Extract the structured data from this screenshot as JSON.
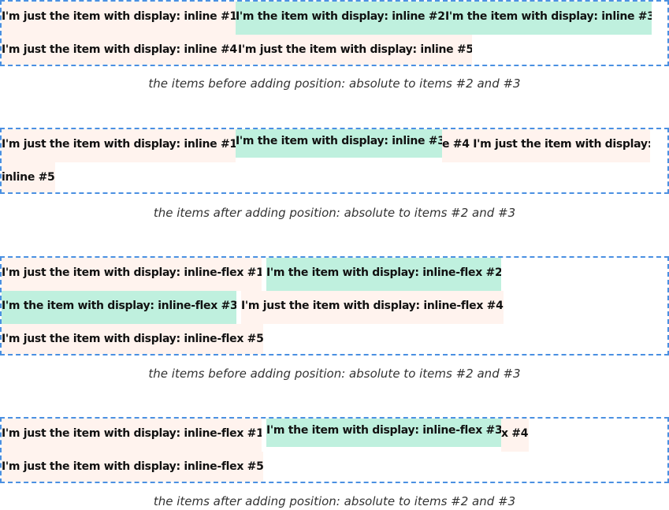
{
  "demos": [
    {
      "caption": "the items before adding position: absolute to items #2 and #3",
      "items": [
        "I'm just the item with display: inline #1",
        "I'm the item with display: inline #2",
        "I'm the item with display: inline #3",
        "I'm just the item with display: inline #4",
        "I'm just the item with display: inline #5"
      ]
    },
    {
      "caption": "the items after adding position: absolute to items #2 and #3",
      "items": [
        "I'm just the item with display: inline #1",
        "I'm the item with display: inline #3",
        "e #4 I'm just the item with display:",
        "inline #5"
      ]
    },
    {
      "caption": "the items before adding position: absolute to items #2 and #3",
      "items": [
        "I'm just the item with display: inline-flex #1",
        "I'm the item with display: inline-flex #2",
        "I'm the item with display: inline-flex #3",
        "I'm just the item with display: inline-flex #4",
        "I'm just the item with display: inline-flex #5"
      ]
    },
    {
      "caption": "the items after adding position: absolute to items #2 and #3",
      "items": [
        "I'm just the item with display: inline-flex #1",
        "I'm the item with display: inline-flex #3",
        "x #4",
        "I'm just the item with display: inline-flex #5"
      ]
    }
  ]
}
